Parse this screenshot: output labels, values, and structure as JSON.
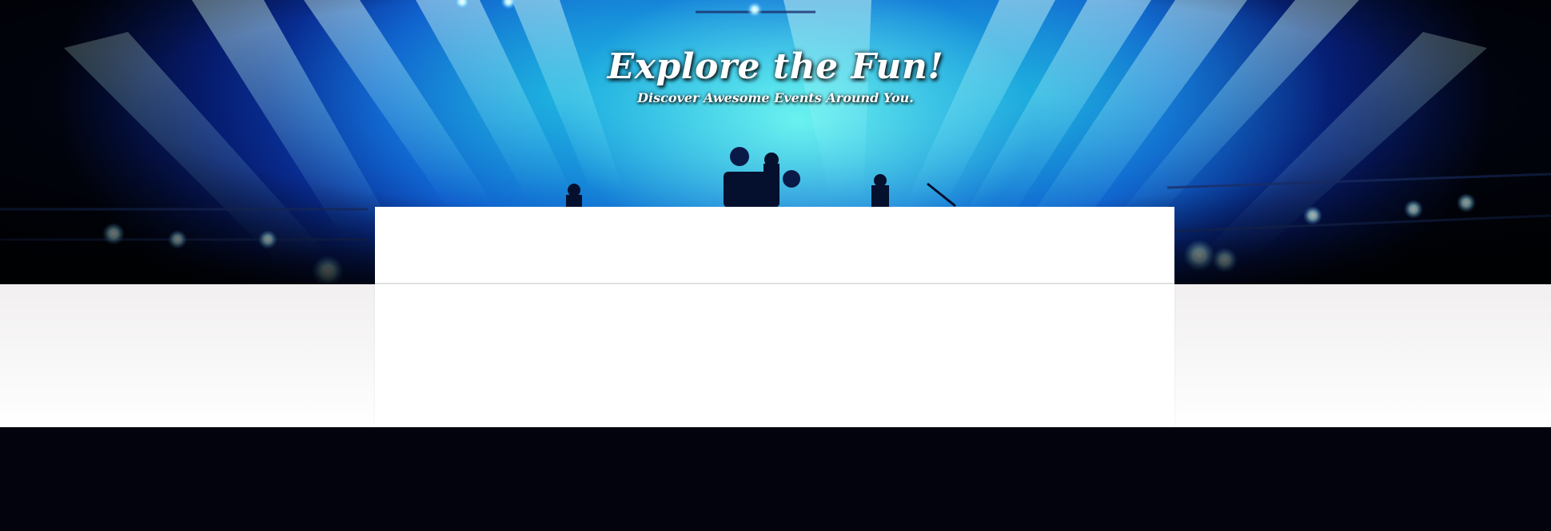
{
  "hero": {
    "title": "Explore the Fun!",
    "subtitle": "Discover Awesome Events Around You."
  },
  "colors": {
    "hero_glow": "#40e6e6",
    "hero_blue": "#0b47c9",
    "band_top": "#f1eff0",
    "card": "#ffffff",
    "footer": "#02030d"
  }
}
